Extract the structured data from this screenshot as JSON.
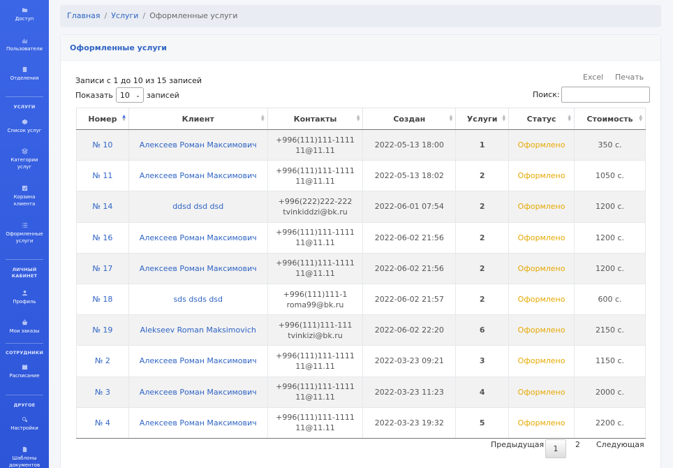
{
  "sidebar": {
    "items": [
      {
        "label": "Доступ",
        "icon": "folder-icon"
      },
      {
        "label": "Пользователи",
        "icon": "chart-icon"
      },
      {
        "label": "Отделения",
        "icon": "building-icon"
      },
      {
        "label": "Список услуг",
        "icon": "box-icon"
      },
      {
        "label": "Категории услуг",
        "icon": "layers-icon"
      },
      {
        "label": "Корзина клиента",
        "icon": "check-square-icon"
      },
      {
        "label": "Оформленные услуги",
        "icon": "list-icon"
      },
      {
        "label": "Профиль",
        "icon": "user-icon"
      },
      {
        "label": "Мои заказы",
        "icon": "basket-icon"
      },
      {
        "label": "Расписание",
        "icon": "calendar-icon"
      },
      {
        "label": "Настройки",
        "icon": "gears-icon"
      },
      {
        "label": "Шаблоны документов",
        "icon": "file-icon"
      }
    ],
    "headings": {
      "services": "УСЛУГИ",
      "cabinet": "ЛИЧНЫЙ КАБИНЕТ",
      "staff": "СОТРУДНИКИ",
      "other": "ДРУГОЕ"
    }
  },
  "breadcrumb": {
    "home": "Главная",
    "services": "Услуги",
    "current": "Оформленные услуги",
    "separator": "/"
  },
  "card": {
    "title": "Оформленные услуги"
  },
  "datatable": {
    "info": "Записи с 1 до 10 из 15 записей",
    "length_prefix": "Показать",
    "length_value": "10",
    "length_suffix": "записей",
    "search_label": "Поиск:",
    "search_value": "",
    "excel_label": "Excel",
    "print_label": "Печать",
    "columns": [
      "Номер",
      "Клиент",
      "Контакты",
      "Создан",
      "Услуги",
      "Статус",
      "Стоимость"
    ],
    "rows": [
      {
        "num": "№ 10",
        "client": "Алексеев Роман Максимович",
        "phone": "+996(111)111-1111",
        "email": "11@11.11",
        "created": "2022-05-13 18:00",
        "services": "1",
        "status": "Оформлено",
        "cost": "350 с."
      },
      {
        "num": "№ 11",
        "client": "Алексеев Роман Максимович",
        "phone": "+996(111)111-1111",
        "email": "11@11.11",
        "created": "2022-05-13 18:02",
        "services": "2",
        "status": "Оформлено",
        "cost": "1050 с."
      },
      {
        "num": "№ 14",
        "client": "ddsd dsd dsd",
        "phone": "+996(222)222-222",
        "email": "tvinkiddzi@bk.ru",
        "created": "2022-06-01 07:54",
        "services": "2",
        "status": "Оформлено",
        "cost": "1200 с."
      },
      {
        "num": "№ 16",
        "client": "Алексеев Роман Максимович",
        "phone": "+996(111)111-1111",
        "email": "11@11.11",
        "created": "2022-06-02 21:56",
        "services": "2",
        "status": "Оформлено",
        "cost": "1200 с."
      },
      {
        "num": "№ 17",
        "client": "Алексеев Роман Максимович",
        "phone": "+996(111)111-1111",
        "email": "11@11.11",
        "created": "2022-06-02 21:56",
        "services": "2",
        "status": "Оформлено",
        "cost": "1200 с."
      },
      {
        "num": "№ 18",
        "client": "sds dsds dsd",
        "phone": "+996(111)111-1",
        "email": "roma99@bk.ru",
        "created": "2022-06-02 21:57",
        "services": "2",
        "status": "Оформлено",
        "cost": "600 с."
      },
      {
        "num": "№ 19",
        "client": "Alekseev Roman Maksimovich",
        "phone": "+996(111)111-111",
        "email": "tvinkizi@bk.ru",
        "created": "2022-06-02 22:20",
        "services": "6",
        "status": "Оформлено",
        "cost": "2150 с."
      },
      {
        "num": "№ 2",
        "client": "Алексеев Роман Максимович",
        "phone": "+996(111)111-1111",
        "email": "11@11.11",
        "created": "2022-03-23 09:21",
        "services": "3",
        "status": "Оформлено",
        "cost": "1150 с."
      },
      {
        "num": "№ 3",
        "client": "Алексеев Роман Максимович",
        "phone": "+996(111)111-1111",
        "email": "11@11.11",
        "created": "2022-03-23 11:23",
        "services": "4",
        "status": "Оформлено",
        "cost": "2000 с."
      },
      {
        "num": "№ 4",
        "client": "Алексеев Роман Максимович",
        "phone": "+996(111)111-1111",
        "email": "11@11.11",
        "created": "2022-03-23 19:32",
        "services": "5",
        "status": "Оформлено",
        "cost": "2200 с."
      }
    ]
  },
  "pagination": {
    "prev": "Предыдущая",
    "page1": "1",
    "page2": "2",
    "next": "Следующая"
  },
  "colors": {
    "sidebar": "#3b66e6",
    "link": "#2f64c4",
    "status": "#e6a800"
  }
}
